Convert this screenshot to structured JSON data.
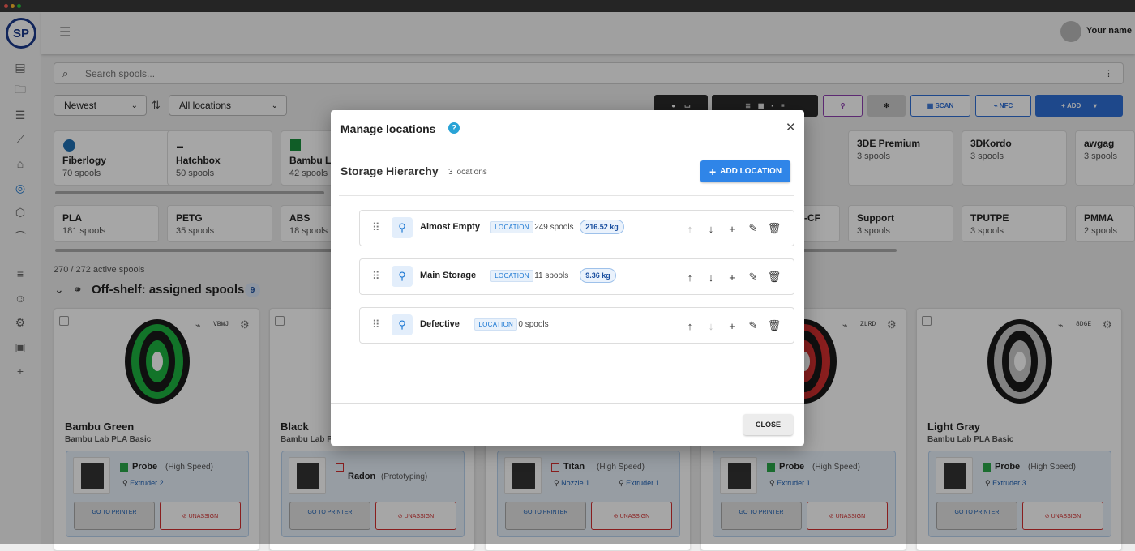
{
  "app": {
    "logo_text": "SP",
    "user_name": "Your name",
    "colors": {
      "accent": "#1976d2",
      "brand": "#1b3a8c",
      "add_button": "#2f6fd6"
    }
  },
  "search": {
    "placeholder": "Search spools..."
  },
  "filters": {
    "sort": "Newest",
    "location": "All locations"
  },
  "toolbar": {
    "scan_label": "SCAN",
    "nfc_label": "NFC",
    "add_label": "ADD"
  },
  "brands": [
    {
      "name": "Fiberlogy",
      "count": "70 spools"
    },
    {
      "name": "Hatchbox",
      "count": "50 spools"
    },
    {
      "name": "Bambu La",
      "count": "42 spools"
    },
    {
      "name": "3DE Premium",
      "count": "3 spools"
    },
    {
      "name": "3DKordo",
      "count": "3 spools"
    },
    {
      "name": "awgag",
      "count": "3 spools"
    }
  ],
  "materials": [
    {
      "name": "PLA",
      "count": "181 spools"
    },
    {
      "name": "PETG",
      "count": "35 spools"
    },
    {
      "name": "ABS",
      "count": "18 spools"
    },
    {
      "name": "-CF",
      "count": ""
    },
    {
      "name": "Support",
      "count": "3 spools"
    },
    {
      "name": "TPUTPE",
      "count": "3 spools"
    },
    {
      "name": "PMMA",
      "count": "2 spools"
    }
  ],
  "summary": {
    "active": "270 / 272 active spools",
    "section_title": "Off-shelf: assigned spools",
    "section_count": "9"
  },
  "spools": [
    {
      "name": "Bambu Green",
      "product": "Bambu Lab PLA Basic",
      "code": "VBWJ",
      "color": "#1db33f",
      "printer": "Probe",
      "mode": "(High Speed)",
      "extruders": [
        "Extruder 2"
      ],
      "status": "#2aa84a",
      "go_label": "GO TO PRINTER",
      "unassign_label": "UNASSIGN"
    },
    {
      "name": "Black",
      "product": "Bambu Lab P",
      "code": "",
      "color": "#222222",
      "printer": "Radon",
      "mode": "(Prototyping)",
      "extruders": [],
      "status": "#d32f2f",
      "go_label": "GO TO PRINTER",
      "unassign_label": "UNASSIGN"
    },
    {
      "name": "",
      "product": "",
      "code": "",
      "color": "#888888",
      "printer": "Titan",
      "mode": "(High Speed)",
      "extruders": [
        "Nozzle 1",
        "Extruder 1"
      ],
      "status": "#d32f2f",
      "go_label": "GO TO PRINTER",
      "unassign_label": "UNASSIGN"
    },
    {
      "name": "",
      "product": "",
      "code": "ZLRD",
      "color": "#d32f2f",
      "printer": "Probe",
      "mode": "(High Speed)",
      "extruders": [
        "Extruder 1"
      ],
      "status": "#2aa84a",
      "go_label": "GO TO PRINTER",
      "unassign_label": "UNASSIGN"
    },
    {
      "name": "Light Gray",
      "product": "Bambu Lab PLA Basic",
      "code": "8D6E",
      "color": "#c8c8c8",
      "printer": "Probe",
      "mode": "(High Speed)",
      "extruders": [
        "Extruder 3"
      ],
      "status": "#2aa84a",
      "go_label": "GO TO PRINTER",
      "unassign_label": "UNASSIGN"
    }
  ],
  "modal": {
    "title": "Manage locations",
    "section_title": "Storage Hierarchy",
    "section_count": "3 locations",
    "add_label": "ADD LOCATION",
    "close_label": "CLOSE",
    "locations": [
      {
        "name": "Almost Empty",
        "badge": "LOCATION",
        "spools": "249 spools",
        "weight": "216.52 kg",
        "up_disabled": true,
        "down_disabled": false
      },
      {
        "name": "Main Storage",
        "badge": "LOCATION",
        "spools": "11 spools",
        "weight": "9.36 kg",
        "up_disabled": false,
        "down_disabled": false
      },
      {
        "name": "Defective",
        "badge": "LOCATION",
        "spools": "0 spools",
        "weight": "",
        "up_disabled": false,
        "down_disabled": true
      }
    ]
  }
}
